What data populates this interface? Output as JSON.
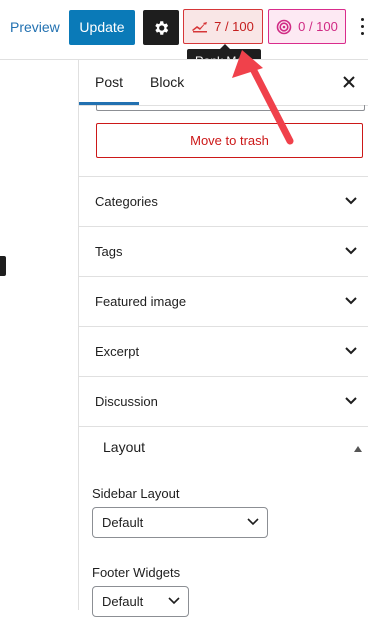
{
  "toolbar": {
    "preview_label": "Preview",
    "update_label": "Update",
    "rank_math_score": "7 / 100",
    "content_ai_score": "0 / 100",
    "tooltip": "Rank Ma",
    "colors": {
      "primary": "#0a7ab8",
      "rank_math": "#d63638",
      "content_ai": "#d92c8c"
    }
  },
  "sidebar": {
    "tabs": [
      {
        "label": "Post"
      },
      {
        "label": "Block"
      }
    ],
    "close_icon": "close-icon",
    "trash_label": "Move to trash",
    "panels": [
      {
        "label": "Categories"
      },
      {
        "label": "Tags"
      },
      {
        "label": "Featured image"
      },
      {
        "label": "Excerpt"
      },
      {
        "label": "Discussion"
      }
    ],
    "layout": {
      "title": "Layout",
      "sidebar_layout_label": "Sidebar Layout",
      "sidebar_layout_value": "Default",
      "footer_widgets_label": "Footer Widgets",
      "footer_widgets_value": "Default"
    }
  },
  "annotation": {
    "arrow_color": "#f0414b"
  }
}
